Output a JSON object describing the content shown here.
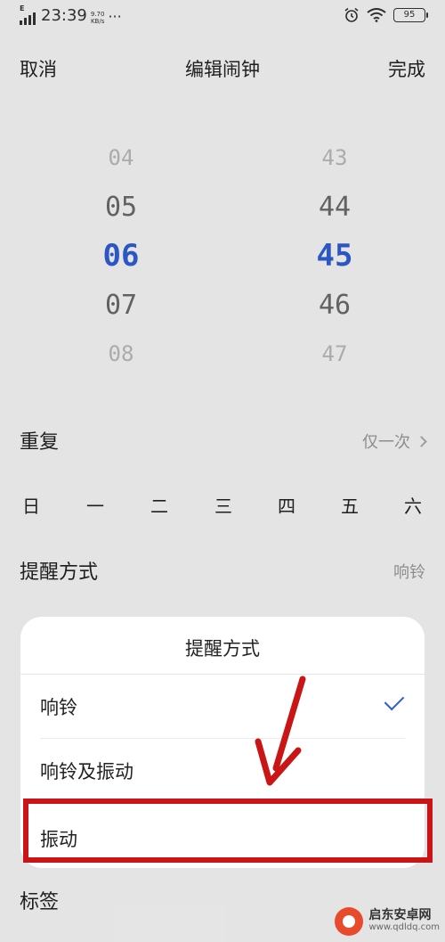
{
  "status_bar": {
    "network": "E",
    "time": "23:39",
    "speed_value": "9.70",
    "speed_unit": "KB/s",
    "more": "···",
    "battery": "95"
  },
  "header": {
    "cancel_label": "取消",
    "title": "编辑闹钟",
    "done_label": "完成"
  },
  "picker": {
    "hours": [
      "04",
      "05",
      "06",
      "07",
      "08"
    ],
    "minutes": [
      "43",
      "44",
      "45",
      "46",
      "47"
    ],
    "selected_hour": "06",
    "selected_minute": "45"
  },
  "repeat": {
    "label": "重复",
    "value": "仅一次"
  },
  "days": [
    "日",
    "一",
    "二",
    "三",
    "四",
    "五",
    "六"
  ],
  "alert": {
    "label": "提醒方式",
    "value": "响铃"
  },
  "tag": {
    "label": "标签"
  },
  "sheet": {
    "title": "提醒方式",
    "options": [
      {
        "label": "响铃",
        "selected": true
      },
      {
        "label": "响铃及振动",
        "selected": false
      },
      {
        "label": "振动",
        "selected": false
      }
    ]
  },
  "watermark": {
    "name": "启东安卓网",
    "url": "www.qdldq.com"
  },
  "colors": {
    "accent": "#2f5dd3",
    "highlight": "#c91515"
  }
}
